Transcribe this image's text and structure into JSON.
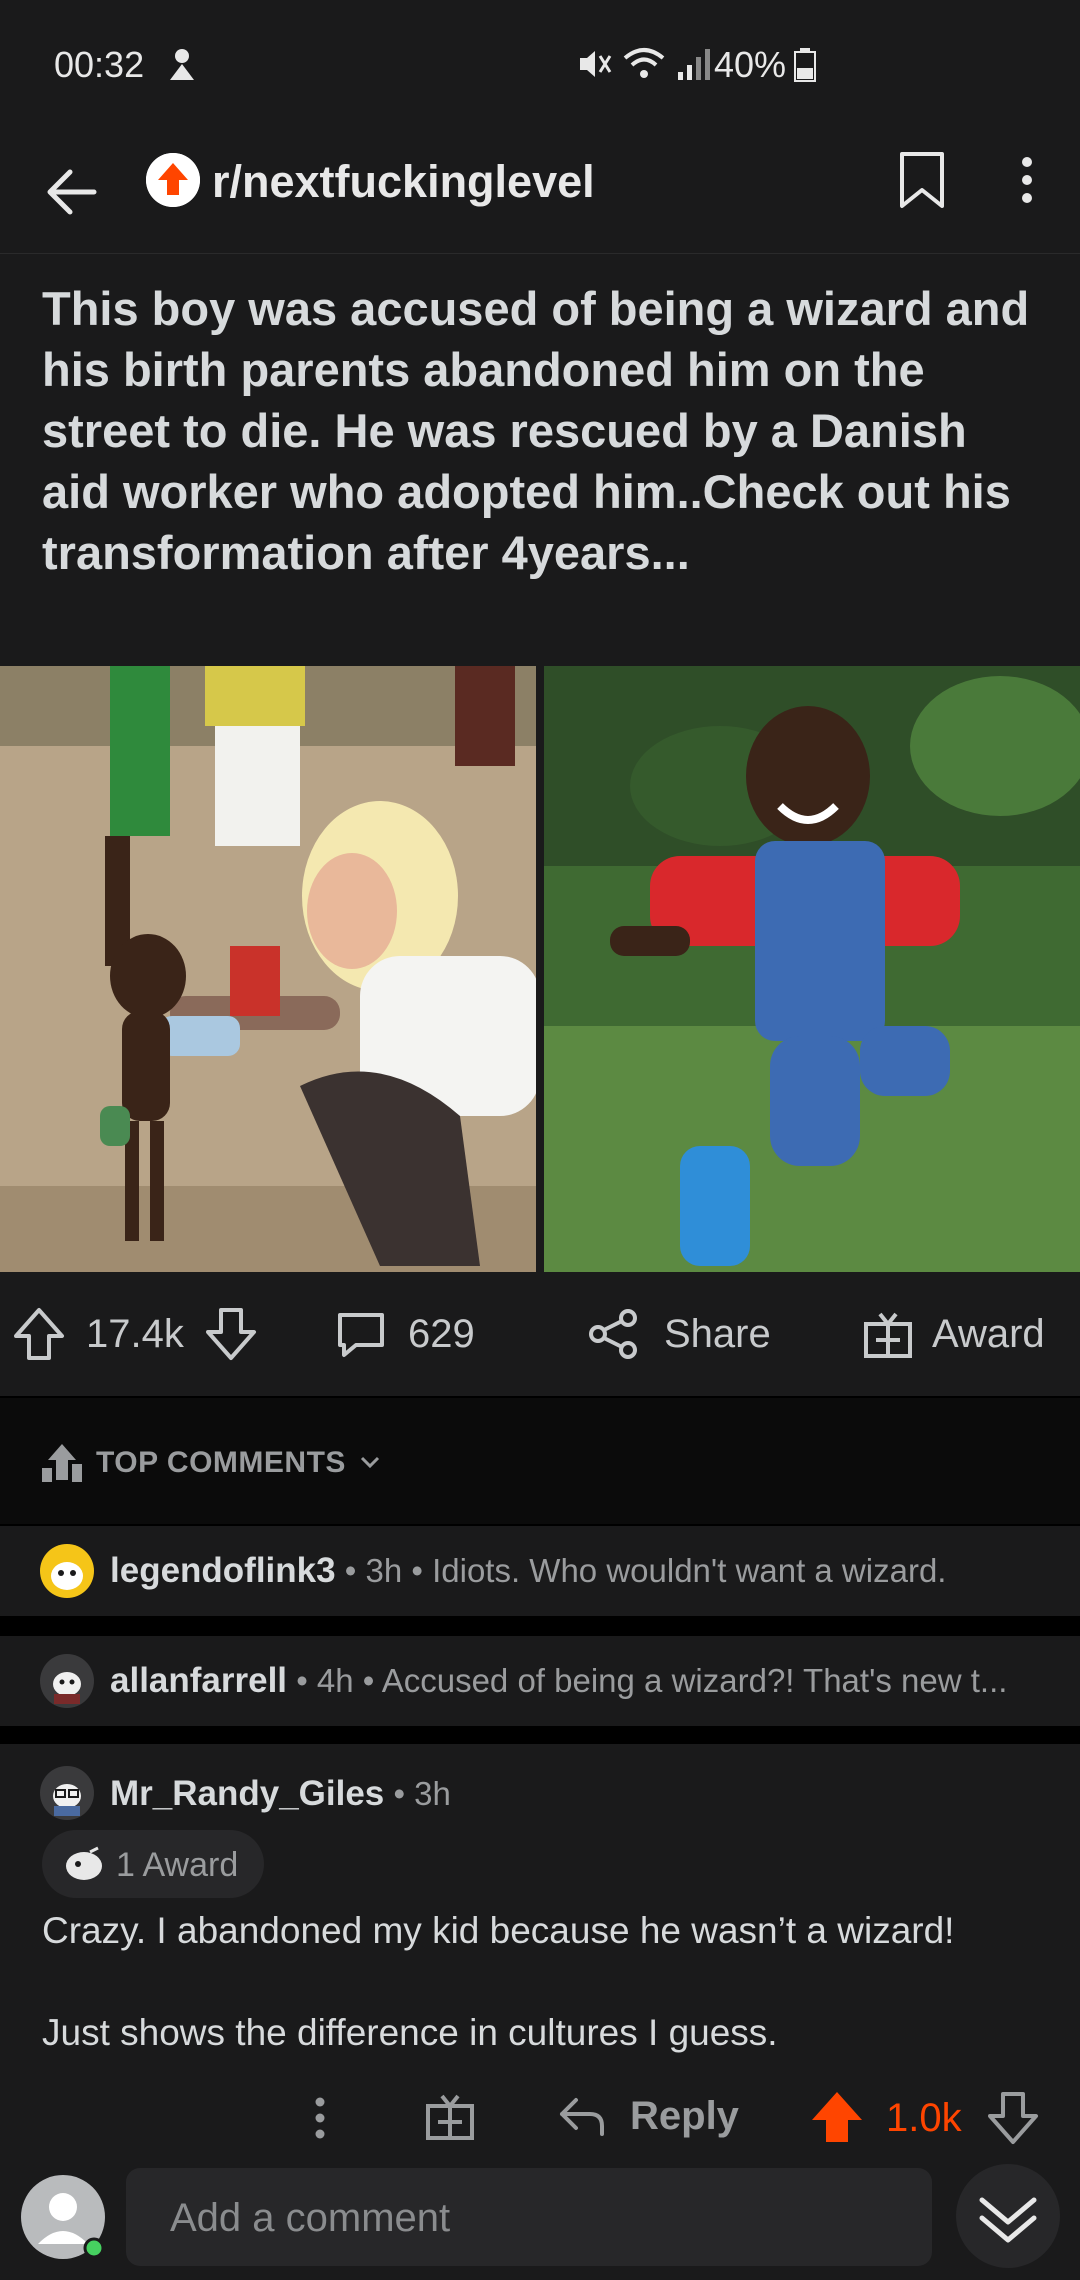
{
  "status_bar": {
    "time": "00:32",
    "battery": "40%"
  },
  "app_bar": {
    "subreddit": "r/nextfuckinglevel"
  },
  "post": {
    "title": "This boy was accused of being a wizard and his birth parents abandoned him on the street to die. He was rescued by a Danish aid worker who adopted him..Check out his transformation after 4years..."
  },
  "actions": {
    "votes": "17.4k",
    "comments": "629",
    "share": "Share",
    "award": "Award"
  },
  "sort": {
    "label": "TOP COMMENTS"
  },
  "comments": [
    {
      "user": "legendoflink3",
      "meta": " • 3h • ",
      "text": "Idiots.  Who wouldn't want a wizard."
    },
    {
      "user": "allanfarrell",
      "meta": " • 4h • ",
      "text": "Accused of being a wizard?! That's new t..."
    }
  ],
  "expanded_comment": {
    "user": "Mr_Randy_Giles",
    "meta": " • 3h",
    "award": "1 Award",
    "body_line1": "Crazy. I abandoned my kid because he wasn’t a wizard!",
    "body_line2": "Just shows the difference in cultures I guess.",
    "reply": "Reply",
    "score": "1.0k"
  },
  "composer": {
    "placeholder": "Add a comment"
  },
  "colors": {
    "upvote_orange": "#ff4500",
    "background": "#1a1a1b",
    "text": "#d7dadc"
  }
}
